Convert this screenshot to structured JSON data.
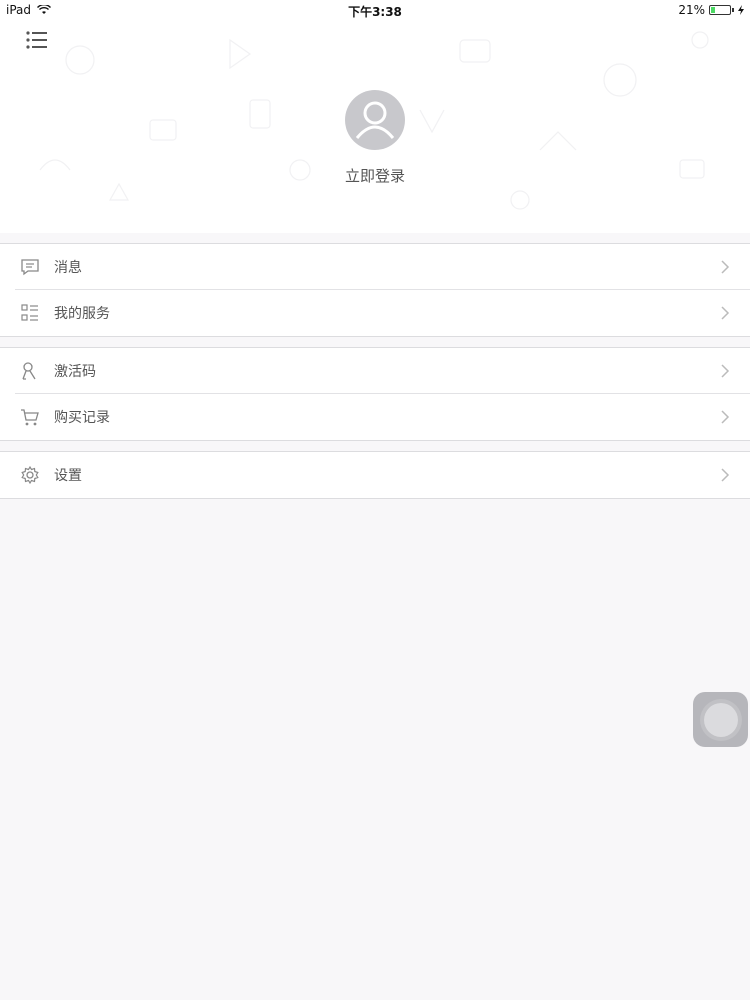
{
  "status_bar": {
    "device": "iPad",
    "time": "下午3:38",
    "battery": "21%",
    "battery_level": 0.21
  },
  "header": {
    "login_label": "立即登录"
  },
  "menu": {
    "groups": [
      {
        "items": [
          {
            "label": "消息",
            "icon": "message-icon"
          },
          {
            "label": "我的服务",
            "icon": "services-list-icon"
          }
        ]
      },
      {
        "items": [
          {
            "label": "激活码",
            "icon": "key-icon"
          },
          {
            "label": "购买记录",
            "icon": "cart-icon"
          }
        ]
      },
      {
        "items": [
          {
            "label": "设置",
            "icon": "gear-icon"
          }
        ]
      }
    ]
  },
  "colors": {
    "background": "#f8f7f9",
    "avatar": "#c8c8cc",
    "text": "#555555",
    "battery_fill": "#4cd964"
  }
}
